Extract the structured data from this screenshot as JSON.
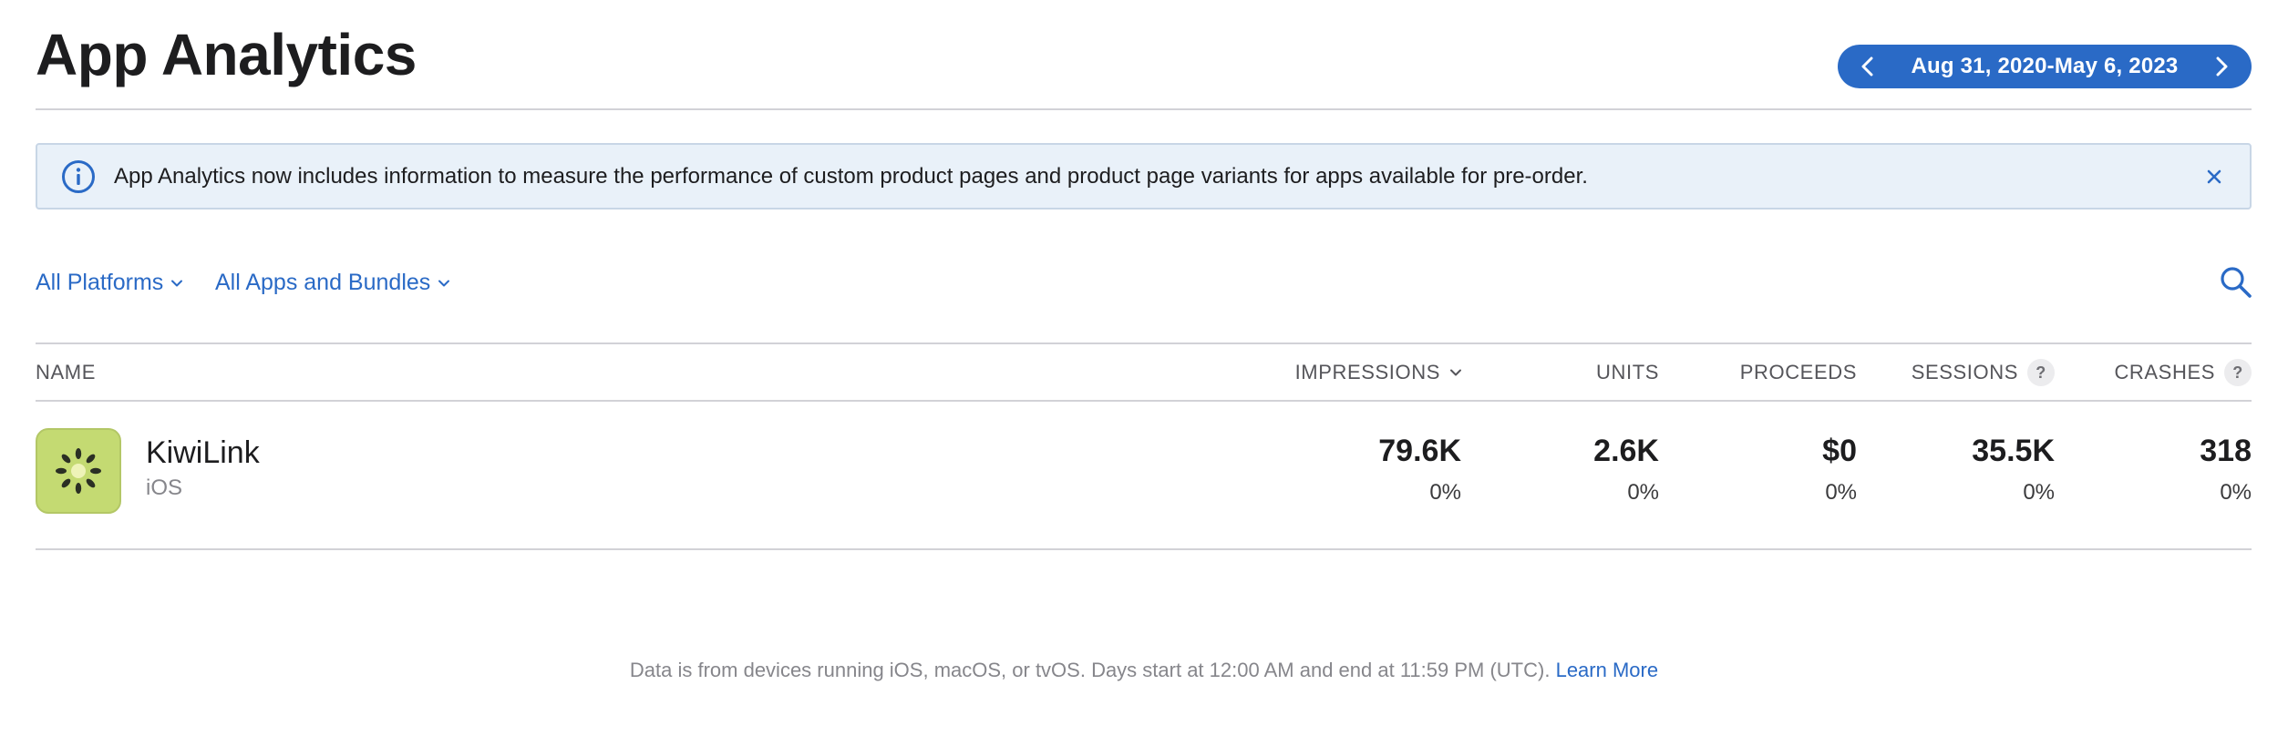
{
  "page": {
    "title": "App Analytics"
  },
  "date_range": {
    "label": "Aug 31, 2020-May 6, 2023",
    "prev_icon": "chevron-left-icon",
    "next_icon": "chevron-right-icon"
  },
  "banner": {
    "message": "App Analytics now includes information to measure the performance of custom product pages and product page variants for apps available for pre-order.",
    "info_icon": "info-circle-icon",
    "close_icon": "close-icon"
  },
  "filters": {
    "platforms": "All Platforms",
    "apps": "All Apps and Bundles",
    "search_icon": "search-icon"
  },
  "table": {
    "columns": {
      "name": "NAME",
      "impressions": "IMPRESSIONS",
      "units": "UNITS",
      "proceeds": "PROCEEDS",
      "sessions": "SESSIONS",
      "crashes": "CRASHES",
      "help_badge": "?"
    },
    "rows": [
      {
        "name": "KiwiLink",
        "platform": "iOS",
        "impressions": {
          "value": "79.6K",
          "change": "0%"
        },
        "units": {
          "value": "2.6K",
          "change": "0%"
        },
        "proceeds": {
          "value": "$0",
          "change": "0%"
        },
        "sessions": {
          "value": "35.5K",
          "change": "0%"
        },
        "crashes": {
          "value": "318",
          "change": "0%"
        }
      }
    ]
  },
  "footer": {
    "text": "Data is from devices running iOS, macOS, or tvOS. Days start at 12:00 AM and end at 11:59 PM (UTC).",
    "link": "Learn More"
  },
  "colors": {
    "accent": "#2a6ac6",
    "banner_bg": "#e9f1f9",
    "app_icon_bg": "#c4da72"
  }
}
